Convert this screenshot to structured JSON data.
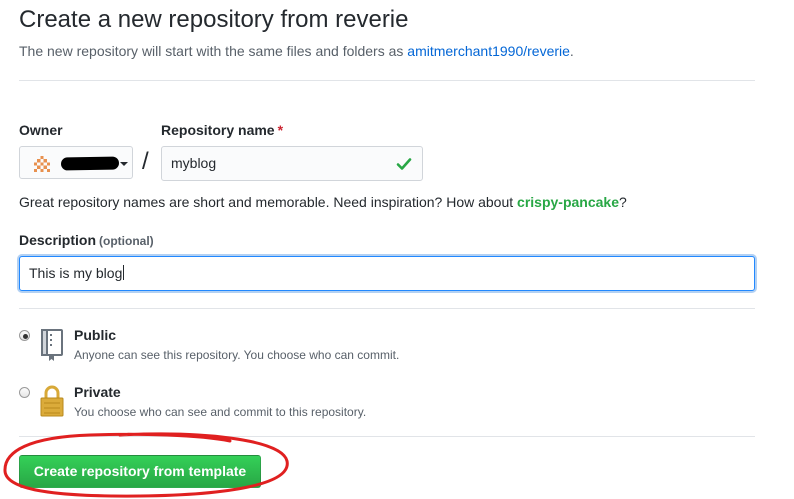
{
  "page": {
    "title": "Create a new repository from reverie",
    "subtitle_prefix": "The new repository will start with the same files and folders as",
    "template_link": "amitmerchant1990/reverie",
    "subtitle_suffix": "."
  },
  "form": {
    "owner_label": "Owner",
    "repo_name_label": "Repository name",
    "required_mark": "*",
    "separator": "/",
    "repo_name_value": "myblog",
    "hint_text": "Great repository names are short and memorable. Need inspiration? How about",
    "hint_suggestion": "crispy-pancake",
    "hint_end": "?",
    "description_label": "Description",
    "description_optional": "(optional)",
    "description_value": "This is my blog"
  },
  "visibility": {
    "selected": "Public",
    "public": {
      "title": "Public",
      "description": "Anyone can see this repository. You choose who can commit."
    },
    "private": {
      "title": "Private",
      "description": "You choose who can see and commit to this repository."
    }
  },
  "actions": {
    "create_label": "Create repository from template"
  },
  "colors": {
    "primary_button": "#28a745",
    "link": "#0366d6",
    "annotation": "#e02020",
    "focus_border": "#2188ff"
  },
  "icons": {
    "owner_avatar": "identicon-avatar",
    "valid": "check-icon",
    "public": "repo-icon",
    "private": "lock-icon"
  }
}
